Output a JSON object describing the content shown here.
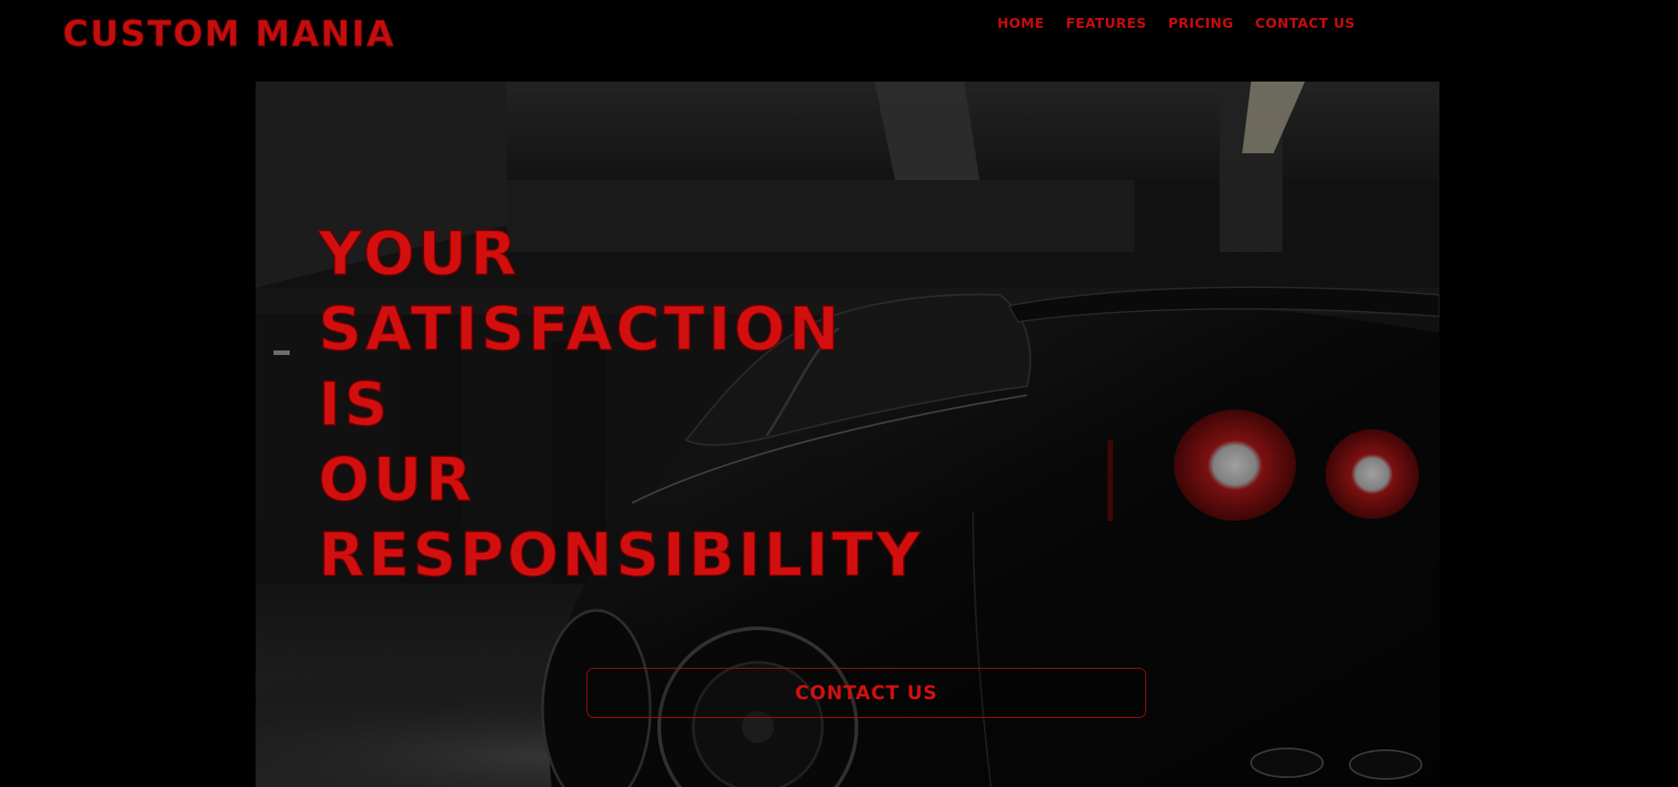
{
  "brand": {
    "name": "CUSTOM MANIA"
  },
  "nav": {
    "items": [
      {
        "label": "HOME"
      },
      {
        "label": "FEATURES"
      },
      {
        "label": "PRICING"
      },
      {
        "label": "CONTACT US"
      }
    ]
  },
  "hero": {
    "headline_lines": [
      "YOUR",
      "SATISFACTION",
      "IS",
      "OUR",
      "RESPONSIBILITY"
    ],
    "cta_label": "CONTACT US",
    "image_subject": "black sports car in a dark parking garage"
  },
  "colors": {
    "accent": "#c40d0d",
    "page_background": "#000000"
  }
}
